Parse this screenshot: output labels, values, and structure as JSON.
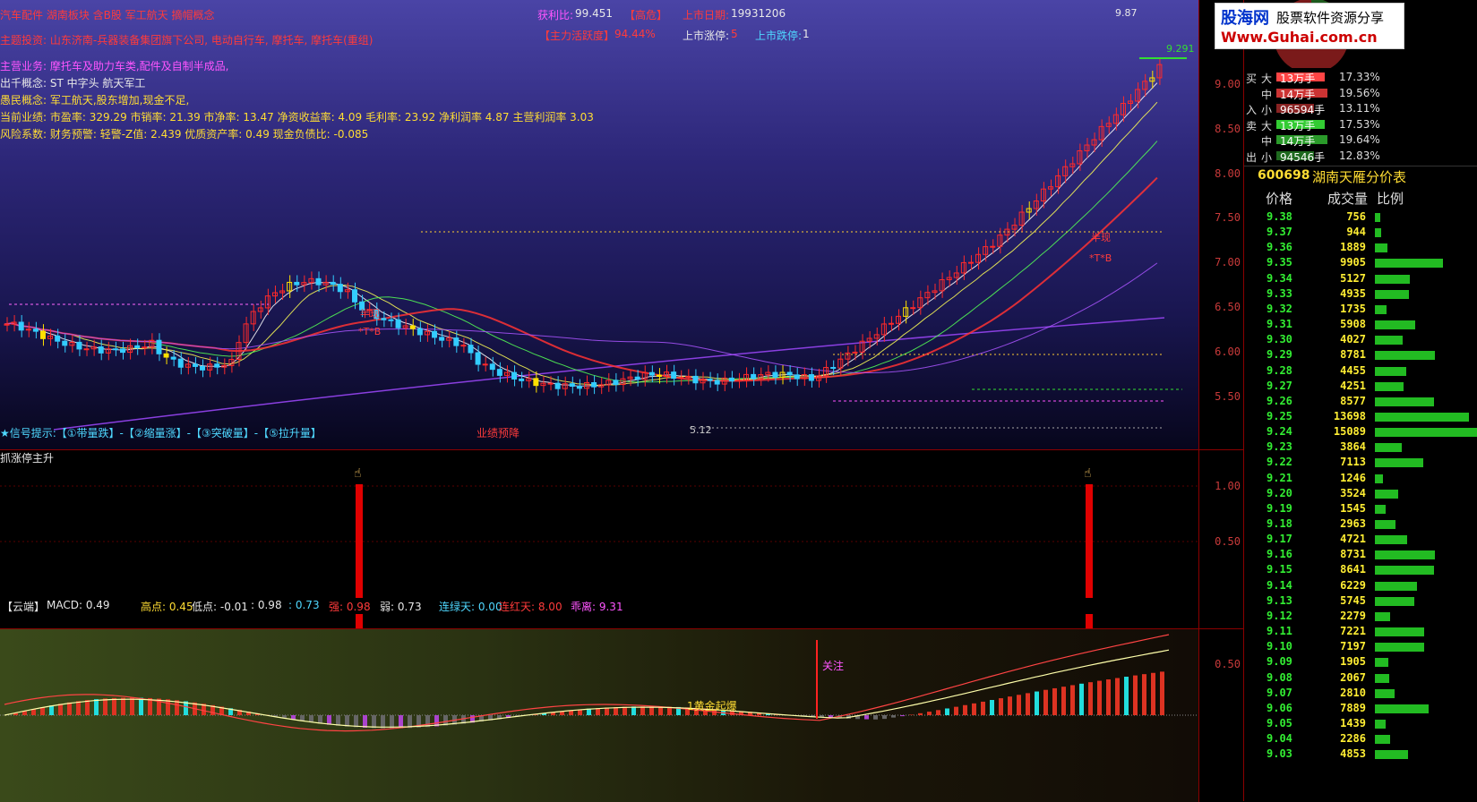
{
  "info_panel": {
    "concept_line": "汽车配件 湖南板块 含B股 军工航天 摘帽概念",
    "theme": "主题投资: 山东济南-兵器装备集团旗下公司, 电动自行车, 摩托车, 摩托车(重组)",
    "main_business": "主营业务: 摩托车及助力车类,配件及自制半成品,",
    "concept_a": "出千概念: ST 中字头 航天军工",
    "concept_b": "愚民概念: 军工航天,股东增加,现金不足,",
    "performance": "当前业绩: 市盈率: 329.29 市销率: 21.39 市净率: 13.47 净资收益率: 4.09 毛利率: 23.92 净利润率 4.87 主营利润率 3.03",
    "risk": "风险系数: 财务预警: 轻警-Z值: 2.439 优质资产率: 0.49 现金负债比: -0.085",
    "profit_ratio_label": "获利比:",
    "profit_ratio_value": "99.451",
    "high_risk": "【高危】",
    "listing_date_label": "上市日期:",
    "listing_date_value": "19931206",
    "main_activity_label": "【主力活跃度】",
    "main_activity_value": "94.44%",
    "limit_up_label": "上市涨停:",
    "limit_up_value": "5",
    "limit_down_label": "上市跌停:",
    "limit_down_value": "1"
  },
  "chart_annotations": {
    "signal_hint": "★信号提示:【①带量跌】-【②缩量涨】-【③突破量】-【⑤拉升量】",
    "performance_drop": "业绩预降",
    "price_high_label": "9.87",
    "price_line_label": "9.291",
    "low_label": "5.12",
    "half_price": "半现",
    "tb_mark": "*T*B",
    "half_price_2": "半现",
    "tb_mark_2": "*T*B"
  },
  "mid_panel": {
    "title": "抓涨停主升",
    "ticks": [
      "1.00",
      "0.50"
    ]
  },
  "macd_panel": {
    "header_name": "【云端】",
    "macd_label": "MACD: 0.49",
    "high_label": "高点: 0.45",
    "low_label": "低点: -0.01",
    "v1": ": 0.98",
    "v2": ": 0.73",
    "strong": "强: 0.98",
    "weak": "弱: 0.73",
    "green_days": "连绿天: 0.00",
    "red_days": "连红天: 8.00",
    "deviation": "乖离: 9.31",
    "gold_cross": "1黄金起爆",
    "attention": "关注",
    "ticks": [
      "0.50"
    ]
  },
  "price_axis": [
    "9.00",
    "8.50",
    "8.00",
    "7.50",
    "7.00",
    "6.50",
    "6.00",
    "5.50"
  ],
  "logo": {
    "site_name": "股海网",
    "slogan": "股票软件资源分享",
    "url": "Www.Guhai.com.cn"
  },
  "capital_flow": {
    "buy_label": "买入",
    "sell_label": "卖出",
    "rows": [
      {
        "side": "买",
        "size": "大",
        "amount": "13万手",
        "pct": "17.33%",
        "color": "#ff4444",
        "fill": 0.9
      },
      {
        "side": "",
        "size": "中",
        "amount": "14万手",
        "pct": "19.56%",
        "color": "#cc3333",
        "fill": 0.95
      },
      {
        "side": "入",
        "size": "小",
        "amount": "96594手",
        "pct": "13.11%",
        "color": "#882222",
        "fill": 0.7
      },
      {
        "side": "卖",
        "size": "大",
        "amount": "13万手",
        "pct": "17.53%",
        "color": "#33cc33",
        "fill": 0.9
      },
      {
        "side": "",
        "size": "中",
        "amount": "14万手",
        "pct": "19.64%",
        "color": "#2a9a2a",
        "fill": 0.95
      },
      {
        "side": "出",
        "size": "小",
        "amount": "94546手",
        "pct": "12.83%",
        "color": "#1f6a1f",
        "fill": 0.7
      }
    ]
  },
  "stock_title": {
    "code": "600698",
    "name": "湖南天雁",
    "view": "分价表"
  },
  "price_table": {
    "headers": [
      "价格",
      "成交量",
      "比例"
    ],
    "rows": [
      {
        "price": "9.38",
        "volume": "756",
        "ratio": 0.05
      },
      {
        "price": "9.37",
        "volume": "944",
        "ratio": 0.06
      },
      {
        "price": "9.36",
        "volume": "1889",
        "ratio": 0.12
      },
      {
        "price": "9.35",
        "volume": "9905",
        "ratio": 0.66
      },
      {
        "price": "9.34",
        "volume": "5127",
        "ratio": 0.34
      },
      {
        "price": "9.33",
        "volume": "4935",
        "ratio": 0.33
      },
      {
        "price": "9.32",
        "volume": "1735",
        "ratio": 0.11
      },
      {
        "price": "9.31",
        "volume": "5908",
        "ratio": 0.39
      },
      {
        "price": "9.30",
        "volume": "4027",
        "ratio": 0.27
      },
      {
        "price": "9.29",
        "volume": "8781",
        "ratio": 0.58
      },
      {
        "price": "9.28",
        "volume": "4455",
        "ratio": 0.3
      },
      {
        "price": "9.27",
        "volume": "4251",
        "ratio": 0.28
      },
      {
        "price": "9.26",
        "volume": "8577",
        "ratio": 0.57
      },
      {
        "price": "9.25",
        "volume": "13698",
        "ratio": 0.91
      },
      {
        "price": "9.24",
        "volume": "15089",
        "ratio": 1.0
      },
      {
        "price": "9.23",
        "volume": "3864",
        "ratio": 0.26
      },
      {
        "price": "9.22",
        "volume": "7113",
        "ratio": 0.47
      },
      {
        "price": "9.21",
        "volume": "1246",
        "ratio": 0.08
      },
      {
        "price": "9.20",
        "volume": "3524",
        "ratio": 0.23
      },
      {
        "price": "9.19",
        "volume": "1545",
        "ratio": 0.1
      },
      {
        "price": "9.18",
        "volume": "2963",
        "ratio": 0.2
      },
      {
        "price": "9.17",
        "volume": "4721",
        "ratio": 0.31
      },
      {
        "price": "9.16",
        "volume": "8731",
        "ratio": 0.58
      },
      {
        "price": "9.15",
        "volume": "8641",
        "ratio": 0.57
      },
      {
        "price": "9.14",
        "volume": "6229",
        "ratio": 0.41
      },
      {
        "price": "9.13",
        "volume": "5745",
        "ratio": 0.38
      },
      {
        "price": "9.12",
        "volume": "2279",
        "ratio": 0.15
      },
      {
        "price": "9.11",
        "volume": "7221",
        "ratio": 0.48
      },
      {
        "price": "9.10",
        "volume": "7197",
        "ratio": 0.48
      },
      {
        "price": "9.09",
        "volume": "1905",
        "ratio": 0.13
      },
      {
        "price": "9.08",
        "volume": "2067",
        "ratio": 0.14
      },
      {
        "price": "9.07",
        "volume": "2810",
        "ratio": 0.19
      },
      {
        "price": "9.06",
        "volume": "7889",
        "ratio": 0.52
      },
      {
        "price": "9.05",
        "volume": "1439",
        "ratio": 0.1
      },
      {
        "price": "9.04",
        "volume": "2286",
        "ratio": 0.15
      },
      {
        "price": "9.03",
        "volume": "4853",
        "ratio": 0.32
      }
    ]
  }
}
